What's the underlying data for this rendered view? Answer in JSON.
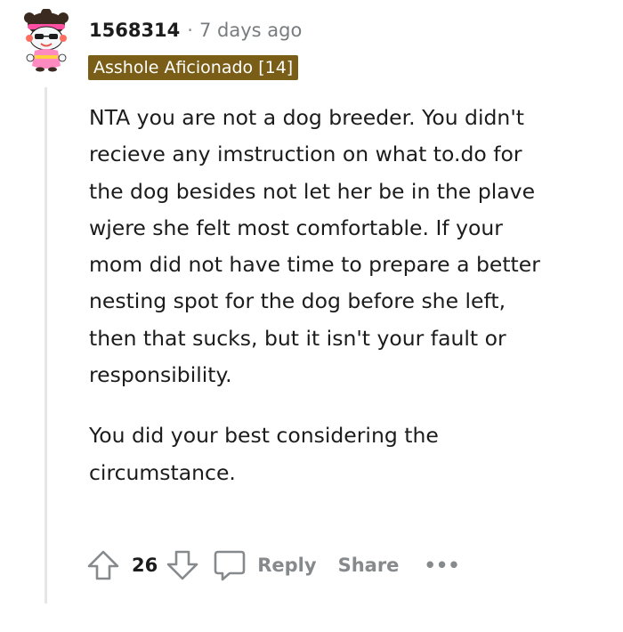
{
  "comment": {
    "username": "1568314",
    "separator": "·",
    "timestamp": "7 days ago",
    "flair": "Asshole Aficionado [14]",
    "paragraphs": [
      "NTA you are not a dog breeder. You didn't recieve any imstruction on what to.do for the dog besides not let her be in the plave wjere she felt most comfortable. If your mom did not have time to prepare a better nesting spot for the dog before she left, then that sucks, but it isn't your fault or responsibility.",
      "You did your best considering the circumstance."
    ],
    "vote_count": "26",
    "reply_label": "Reply",
    "share_label": "Share",
    "more_label": "•••"
  },
  "icons": {
    "avatar": "snoo-avatar",
    "upvote": "upvote-arrow-icon",
    "downvote": "downvote-arrow-icon",
    "reply": "speech-bubble-icon",
    "more": "more-dots-icon"
  },
  "colors": {
    "flair_bg": "#7a5d16",
    "flair_text": "#ffffff",
    "muted": "#878a8c",
    "text": "#1c1c1c",
    "thread_line": "#e6e6e6"
  }
}
